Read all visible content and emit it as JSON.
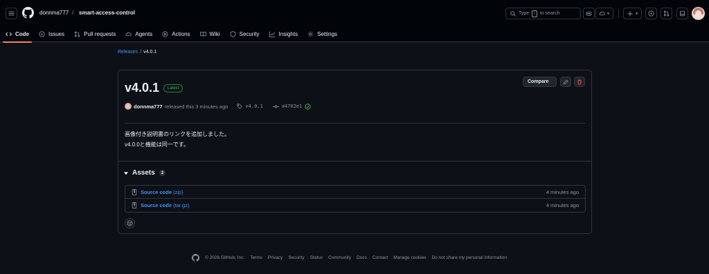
{
  "header": {
    "owner": "donnma777",
    "separator": "/",
    "repo": "smart-access-control",
    "search": {
      "prefix": "Type",
      "key": "/",
      "suffix": "to search"
    }
  },
  "tabs": [
    {
      "label": "Code",
      "icon": "code-icon",
      "active": true
    },
    {
      "label": "Issues",
      "icon": "issue-opened-icon"
    },
    {
      "label": "Pull requests",
      "icon": "git-pull-request-icon"
    },
    {
      "label": "Agents",
      "icon": "agents-icon"
    },
    {
      "label": "Actions",
      "icon": "play-icon"
    },
    {
      "label": "Wiki",
      "icon": "book-icon"
    },
    {
      "label": "Security",
      "icon": "shield-icon"
    },
    {
      "label": "Insights",
      "icon": "graph-icon"
    },
    {
      "label": "Settings",
      "icon": "gear-icon"
    }
  ],
  "breadcrumb": {
    "parent": "Releases",
    "sep": "/",
    "current": "v4.0.1"
  },
  "release": {
    "title": "v4.0.1",
    "badge": "Latest",
    "compare_label": "Compare",
    "author": "donnma777",
    "released_text": "released this 3 minutes ago",
    "tag": "v4.0.1",
    "commit": "a4702e1",
    "body_line1": "画像付き説明書のリンクを追加しました。",
    "body_line2": "v4.0.0と機能は同一です。"
  },
  "assets": {
    "heading": "Assets",
    "count": "2",
    "items": [
      {
        "name": "Source code",
        "ext": "(zip)",
        "time": "4 minutes ago"
      },
      {
        "name": "Source code",
        "ext": "(tar.gz)",
        "time": "4 minutes ago"
      }
    ]
  },
  "footer": {
    "copyright": "© 2026 GitHub, Inc.",
    "links": [
      "Terms",
      "Privacy",
      "Security",
      "Status",
      "Community",
      "Docs",
      "Contact",
      "Manage cookies",
      "Do not share my personal information"
    ]
  },
  "colors": {
    "bg": "#0d1117",
    "header_bg": "#010409",
    "border": "#30363d",
    "link": "#4493f8",
    "active_tab": "#f78166",
    "success": "#3fb950",
    "danger": "#f85149"
  }
}
